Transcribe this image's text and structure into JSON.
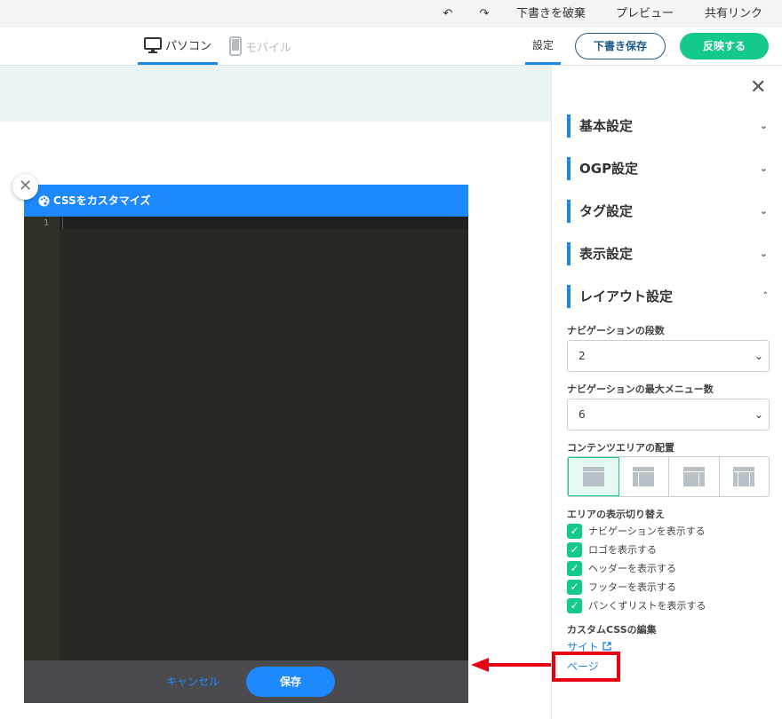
{
  "topbar": {
    "undo_icon": "undo-icon",
    "redo_icon": "redo-icon",
    "discard_label": "下書きを破棄",
    "preview_label": "プレビュー",
    "share_label": "共有リンク"
  },
  "navbar": {
    "tab_pc_label": "パソコン",
    "tab_mobile_label": "モバイル",
    "settings_label": "設定",
    "save_draft_label": "下書き保存",
    "publish_label": "反映する"
  },
  "css_editor": {
    "title": "CSSをカスタマイズ",
    "line_numbers": [
      "1"
    ],
    "cancel_label": "キャンセル",
    "save_label": "保存"
  },
  "panel": {
    "sections": [
      {
        "label": "基本設定",
        "expanded": false
      },
      {
        "label": "OGP設定",
        "expanded": false
      },
      {
        "label": "タグ設定",
        "expanded": false
      },
      {
        "label": "表示設定",
        "expanded": false
      },
      {
        "label": "レイアウト設定",
        "expanded": true
      }
    ],
    "nav_rows_label": "ナビゲーションの段数",
    "nav_rows_value": "2",
    "nav_max_label": "ナビゲーションの最大メニュー数",
    "nav_max_value": "6",
    "content_area_label": "コンテンツエリアの配置",
    "layout_options": [
      "full-width",
      "left-sidebar",
      "right-sidebar",
      "two-sidebars"
    ],
    "layout_selected": 0,
    "area_toggle_label": "エリアの表示切り替え",
    "toggles": [
      {
        "label": "ナビゲーションを表示する",
        "checked": true
      },
      {
        "label": "ロゴを表示する",
        "checked": true
      },
      {
        "label": "ヘッダーを表示する",
        "checked": true
      },
      {
        "label": "フッターを表示する",
        "checked": true
      },
      {
        "label": "パンくずリストを表示する",
        "checked": true
      }
    ],
    "custom_css_label": "カスタムCSSの編集",
    "link_site": "サイト",
    "link_page": "ページ"
  },
  "colors": {
    "accent": "#1e88e5",
    "publish": "#14c98e",
    "annotation": "#e60012",
    "editor_bg": "#272822"
  }
}
